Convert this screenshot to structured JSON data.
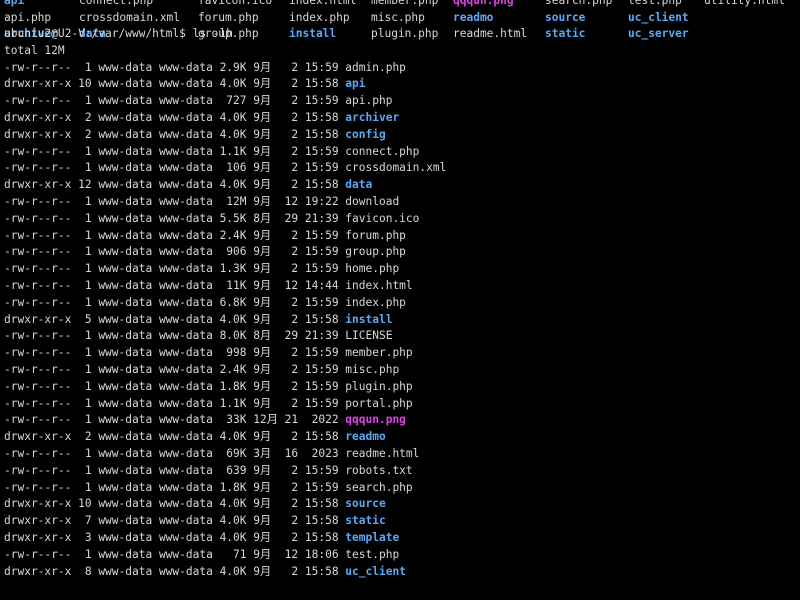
{
  "ls_grid": {
    "columns": [
      [
        {
          "name": "api",
          "kind": "dir"
        },
        {
          "name": "api.php",
          "kind": "file"
        },
        {
          "name": "archiver",
          "kind": "dir"
        }
      ],
      [
        {
          "name": "connect.php",
          "kind": "file"
        },
        {
          "name": "crossdomain.xml",
          "kind": "file"
        },
        {
          "name": "data",
          "kind": "dir"
        }
      ],
      [
        {
          "name": "favicon.ico",
          "kind": "file"
        },
        {
          "name": "forum.php",
          "kind": "file"
        },
        {
          "name": "group.php",
          "kind": "file"
        }
      ],
      [
        {
          "name": "index.html",
          "kind": "file"
        },
        {
          "name": "index.php",
          "kind": "file"
        },
        {
          "name": "install",
          "kind": "dir"
        }
      ],
      [
        {
          "name": "member.php",
          "kind": "file"
        },
        {
          "name": "misc.php",
          "kind": "file"
        },
        {
          "name": "plugin.php",
          "kind": "file"
        }
      ],
      [
        {
          "name": "qqqun.png",
          "kind": "img"
        },
        {
          "name": "readmo",
          "kind": "dir"
        },
        {
          "name": "readme.html",
          "kind": "file"
        }
      ],
      [
        {
          "name": "search.php",
          "kind": "file"
        },
        {
          "name": "source",
          "kind": "dir"
        },
        {
          "name": "static",
          "kind": "dir"
        }
      ],
      [
        {
          "name": "test.php",
          "kind": "file"
        },
        {
          "name": "uc_client",
          "kind": "dir"
        },
        {
          "name": "uc_server",
          "kind": "dir"
        }
      ],
      [
        {
          "name": "utility.html",
          "kind": "file"
        },
        {
          "name": "",
          "kind": "file"
        },
        {
          "name": "",
          "kind": "file"
        }
      ]
    ]
  },
  "prompt": "ubuntu2@U2-V:/var/www/html$ ls -lh",
  "total": "total 12M",
  "entries": [
    {
      "perm": "-rw-r--r--",
      "links": "1",
      "owner": "www-data",
      "group": "www-data",
      "size": "2.9K",
      "month": "9月",
      "day": "2",
      "time": "15:59",
      "name": "admin.php",
      "kind": "file"
    },
    {
      "perm": "drwxr-xr-x",
      "links": "10",
      "owner": "www-data",
      "group": "www-data",
      "size": "4.0K",
      "month": "9月",
      "day": "2",
      "time": "15:58",
      "name": "api",
      "kind": "dir"
    },
    {
      "perm": "-rw-r--r--",
      "links": "1",
      "owner": "www-data",
      "group": "www-data",
      "size": "727",
      "month": "9月",
      "day": "2",
      "time": "15:59",
      "name": "api.php",
      "kind": "file"
    },
    {
      "perm": "drwxr-xr-x",
      "links": "2",
      "owner": "www-data",
      "group": "www-data",
      "size": "4.0K",
      "month": "9月",
      "day": "2",
      "time": "15:58",
      "name": "archiver",
      "kind": "dir"
    },
    {
      "perm": "drwxr-xr-x",
      "links": "2",
      "owner": "www-data",
      "group": "www-data",
      "size": "4.0K",
      "month": "9月",
      "day": "2",
      "time": "15:58",
      "name": "config",
      "kind": "dir"
    },
    {
      "perm": "-rw-r--r--",
      "links": "1",
      "owner": "www-data",
      "group": "www-data",
      "size": "1.1K",
      "month": "9月",
      "day": "2",
      "time": "15:59",
      "name": "connect.php",
      "kind": "file"
    },
    {
      "perm": "-rw-r--r--",
      "links": "1",
      "owner": "www-data",
      "group": "www-data",
      "size": "106",
      "month": "9月",
      "day": "2",
      "time": "15:59",
      "name": "crossdomain.xml",
      "kind": "file"
    },
    {
      "perm": "drwxr-xr-x",
      "links": "12",
      "owner": "www-data",
      "group": "www-data",
      "size": "4.0K",
      "month": "9月",
      "day": "2",
      "time": "15:58",
      "name": "data",
      "kind": "dir"
    },
    {
      "perm": "-rw-r--r--",
      "links": "1",
      "owner": "www-data",
      "group": "www-data",
      "size": "12M",
      "month": "9月",
      "day": "12",
      "time": "19:22",
      "name": "download",
      "kind": "file"
    },
    {
      "perm": "-rw-r--r--",
      "links": "1",
      "owner": "www-data",
      "group": "www-data",
      "size": "5.5K",
      "month": "8月",
      "day": "29",
      "time": "21:39",
      "name": "favicon.ico",
      "kind": "file"
    },
    {
      "perm": "-rw-r--r--",
      "links": "1",
      "owner": "www-data",
      "group": "www-data",
      "size": "2.4K",
      "month": "9月",
      "day": "2",
      "time": "15:59",
      "name": "forum.php",
      "kind": "file"
    },
    {
      "perm": "-rw-r--r--",
      "links": "1",
      "owner": "www-data",
      "group": "www-data",
      "size": "906",
      "month": "9月",
      "day": "2",
      "time": "15:59",
      "name": "group.php",
      "kind": "file"
    },
    {
      "perm": "-rw-r--r--",
      "links": "1",
      "owner": "www-data",
      "group": "www-data",
      "size": "1.3K",
      "month": "9月",
      "day": "2",
      "time": "15:59",
      "name": "home.php",
      "kind": "file"
    },
    {
      "perm": "-rw-r--r--",
      "links": "1",
      "owner": "www-data",
      "group": "www-data",
      "size": "11K",
      "month": "9月",
      "day": "12",
      "time": "14:44",
      "name": "index.html",
      "kind": "file"
    },
    {
      "perm": "-rw-r--r--",
      "links": "1",
      "owner": "www-data",
      "group": "www-data",
      "size": "6.8K",
      "month": "9月",
      "day": "2",
      "time": "15:59",
      "name": "index.php",
      "kind": "file"
    },
    {
      "perm": "drwxr-xr-x",
      "links": "5",
      "owner": "www-data",
      "group": "www-data",
      "size": "4.0K",
      "month": "9月",
      "day": "2",
      "time": "15:58",
      "name": "install",
      "kind": "dir"
    },
    {
      "perm": "-rw-r--r--",
      "links": "1",
      "owner": "www-data",
      "group": "www-data",
      "size": "8.0K",
      "month": "8月",
      "day": "29",
      "time": "21:39",
      "name": "LICENSE",
      "kind": "file"
    },
    {
      "perm": "-rw-r--r--",
      "links": "1",
      "owner": "www-data",
      "group": "www-data",
      "size": "998",
      "month": "9月",
      "day": "2",
      "time": "15:59",
      "name": "member.php",
      "kind": "file"
    },
    {
      "perm": "-rw-r--r--",
      "links": "1",
      "owner": "www-data",
      "group": "www-data",
      "size": "2.4K",
      "month": "9月",
      "day": "2",
      "time": "15:59",
      "name": "misc.php",
      "kind": "file"
    },
    {
      "perm": "-rw-r--r--",
      "links": "1",
      "owner": "www-data",
      "group": "www-data",
      "size": "1.8K",
      "month": "9月",
      "day": "2",
      "time": "15:59",
      "name": "plugin.php",
      "kind": "file"
    },
    {
      "perm": "-rw-r--r--",
      "links": "1",
      "owner": "www-data",
      "group": "www-data",
      "size": "1.1K",
      "month": "9月",
      "day": "2",
      "time": "15:59",
      "name": "portal.php",
      "kind": "file"
    },
    {
      "perm": "-rw-r--r--",
      "links": "1",
      "owner": "www-data",
      "group": "www-data",
      "size": "33K",
      "month": "12月",
      "day": "21",
      "time": "2022",
      "name": "qqqun.png",
      "kind": "img"
    },
    {
      "perm": "drwxr-xr-x",
      "links": "2",
      "owner": "www-data",
      "group": "www-data",
      "size": "4.0K",
      "month": "9月",
      "day": "2",
      "time": "15:58",
      "name": "readmo",
      "kind": "dir"
    },
    {
      "perm": "-rw-r--r--",
      "links": "1",
      "owner": "www-data",
      "group": "www-data",
      "size": "69K",
      "month": "3月",
      "day": "16",
      "time": "2023",
      "name": "readme.html",
      "kind": "file"
    },
    {
      "perm": "-rw-r--r--",
      "links": "1",
      "owner": "www-data",
      "group": "www-data",
      "size": "639",
      "month": "9月",
      "day": "2",
      "time": "15:59",
      "name": "robots.txt",
      "kind": "file"
    },
    {
      "perm": "-rw-r--r--",
      "links": "1",
      "owner": "www-data",
      "group": "www-data",
      "size": "1.8K",
      "month": "9月",
      "day": "2",
      "time": "15:59",
      "name": "search.php",
      "kind": "file"
    },
    {
      "perm": "drwxr-xr-x",
      "links": "10",
      "owner": "www-data",
      "group": "www-data",
      "size": "4.0K",
      "month": "9月",
      "day": "2",
      "time": "15:58",
      "name": "source",
      "kind": "dir"
    },
    {
      "perm": "drwxr-xr-x",
      "links": "7",
      "owner": "www-data",
      "group": "www-data",
      "size": "4.0K",
      "month": "9月",
      "day": "2",
      "time": "15:58",
      "name": "static",
      "kind": "dir"
    },
    {
      "perm": "drwxr-xr-x",
      "links": "3",
      "owner": "www-data",
      "group": "www-data",
      "size": "4.0K",
      "month": "9月",
      "day": "2",
      "time": "15:58",
      "name": "template",
      "kind": "dir"
    },
    {
      "perm": "-rw-r--r--",
      "links": "1",
      "owner": "www-data",
      "group": "www-data",
      "size": "71",
      "month": "9月",
      "day": "12",
      "time": "18:06",
      "name": "test.php",
      "kind": "file"
    },
    {
      "perm": "drwxr-xr-x",
      "links": "8",
      "owner": "www-data",
      "group": "www-data",
      "size": "4.0K",
      "month": "9月",
      "day": "2",
      "time": "15:58",
      "name": "uc_client",
      "kind": "dir"
    }
  ],
  "colors": {
    "background": "#000000",
    "text": "#d8d8d8",
    "directory": "#5aa9f5",
    "image": "#e040e8"
  }
}
